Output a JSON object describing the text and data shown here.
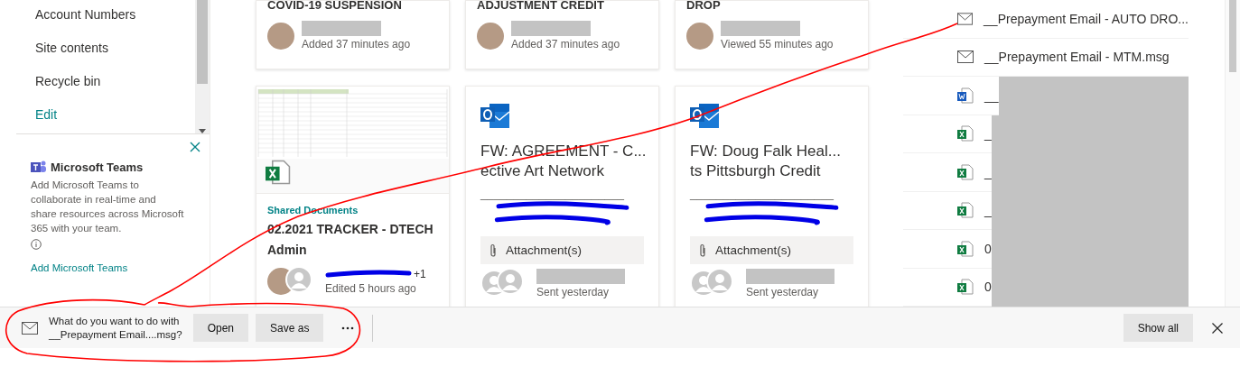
{
  "sidebar": {
    "nav_items": [
      {
        "label": "Account Numbers",
        "kind": "item"
      },
      {
        "label": "Site contents",
        "kind": "item"
      },
      {
        "label": "Recycle bin",
        "kind": "item"
      },
      {
        "label": "Edit",
        "kind": "link"
      }
    ]
  },
  "teams_panel": {
    "title": "Microsoft Teams",
    "description": "Add Microsoft Teams to collaborate in real-time and share resources across Microsoft 365 with your team.",
    "link": "Add Microsoft Teams"
  },
  "cards_top": [
    {
      "title": "COVID-19 SUSPENSION",
      "name_redacted": true,
      "activity": "Added 37 minutes ago"
    },
    {
      "title": "ADJUSTMENT CREDIT",
      "name_redacted": true,
      "activity": "Added 37 minutes ago"
    },
    {
      "title": "DROP",
      "name_redacted": true,
      "activity": "Viewed 55 minutes ago"
    }
  ],
  "cards": [
    {
      "kind": "excel",
      "location": "Shared Documents",
      "title": "02.2021 TRACKER - DTECH Admin",
      "name_redacted": true,
      "extra_people": "+1",
      "activity": "Edited 5 hours ago"
    },
    {
      "kind": "email",
      "title_lines": [
        "FW: AGREEMENT - C...",
        "ective Art Network"
      ],
      "separator": "______________________",
      "from_redacted": true,
      "attachment": "Attachment(s)",
      "name_redacted": true,
      "activity": "Sent yesterday"
    },
    {
      "kind": "email",
      "title_lines": [
        "FW: Doug Falk Heal...",
        "ts Pittsburgh Credit"
      ],
      "separator": "______________________",
      "from_redacted": true,
      "attachment": "Attachment(s)",
      "name_redacted": true,
      "activity": "Sent yesterday"
    }
  ],
  "files": [
    {
      "kind": "email",
      "name": "__Prepayment Email - AUTO DRO...",
      "redacted": false
    },
    {
      "kind": "email",
      "name": "__Prepayment Email - MTM.msg",
      "redacted": false
    },
    {
      "kind": "word",
      "name": "__",
      "redacted": true
    },
    {
      "kind": "excel",
      "name": "_",
      "redacted": true
    },
    {
      "kind": "excel",
      "name": "_",
      "redacted": true
    },
    {
      "kind": "excel",
      "name": "_",
      "redacted": true
    },
    {
      "kind": "excel",
      "name": "0",
      "redacted": true
    },
    {
      "kind": "excel",
      "name": "0",
      "redacted": true
    }
  ],
  "download_bar": {
    "message_lines": [
      "What do you want to do with",
      "__Prepayment Email....msg?"
    ],
    "buttons": [
      "Open",
      "Save as"
    ],
    "show_all": "Show all"
  },
  "annotated": true
}
